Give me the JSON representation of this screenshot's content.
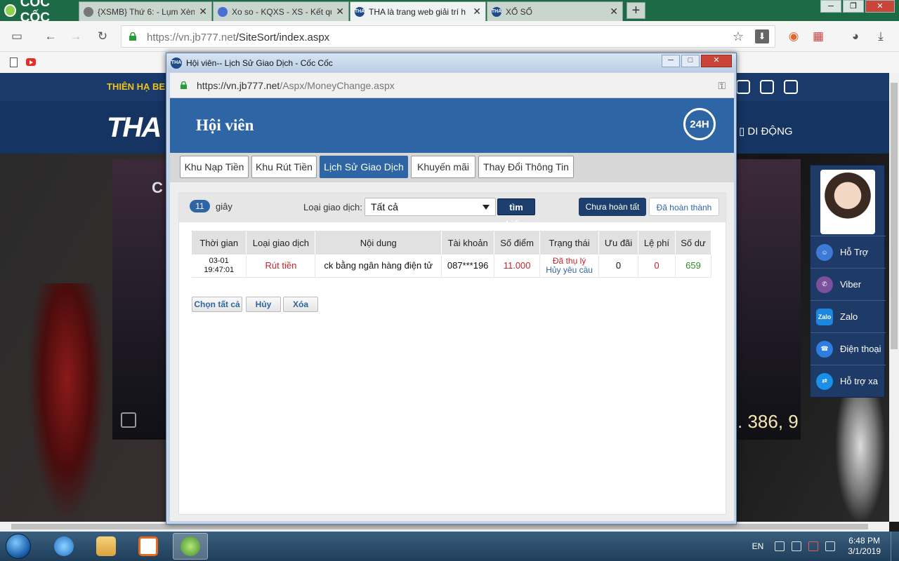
{
  "browser": {
    "brand": "CỐC CỐC",
    "tabs": [
      {
        "label": "{XSMB} Thứ 6: - Lụm Xèn",
        "color": "#777777"
      },
      {
        "label": "Xo so - KQXS - XS - Kết qu",
        "color": "#4a6fd0"
      },
      {
        "label": "THA là trang web giải trí h",
        "color": "#1d4c8c"
      },
      {
        "label": "XỔ SỐ",
        "color": "#1d4c8c"
      }
    ],
    "new_tab": "+",
    "url_host": "https://vn.jb777.net",
    "url_path": "/SiteSort/index.aspx"
  },
  "site": {
    "slogan": "THIÊN HẠ BE",
    "logo": "THA",
    "mobile": "DI ĐỘNG",
    "banner_letter": "C",
    "jackpot": ". 386, 9",
    "support": [
      {
        "label": "Hỗ Trợ",
        "color": "#3d7ad6"
      },
      {
        "label": "Viber",
        "color": "#7b519d"
      },
      {
        "label": "Zalo",
        "color": "#1c86e0"
      },
      {
        "label": "Điện thoại",
        "color": "#2d7ee0"
      },
      {
        "label": "Hỗ trợ xa",
        "color": "#1b8ee8"
      }
    ]
  },
  "popup": {
    "window_title": "Hội viên-- Lịch Sử Giao Dịch - Cốc Cốc",
    "url_host": "https://vn.jb777.net",
    "url_path": "/Aspx/MoneyChange.aspx",
    "header_title": "Hội viên",
    "support_badge": "24H",
    "tabs": [
      {
        "label": "Khu Nạp Tiền"
      },
      {
        "label": "Khu Rút Tiền"
      },
      {
        "label": "Lịch Sử Giao Dịch"
      },
      {
        "label": "Khuyến mãi"
      },
      {
        "label": "Thay Đổi Thông Tin"
      }
    ],
    "refresh_seconds": "11",
    "seconds_unit": "giây",
    "type_label": "Loại giao dịch:",
    "type_value": "Tất cả",
    "search_button": "tìm kiếm",
    "status_pending": "Chưa hoàn tất",
    "status_done": "Đã hoàn thành",
    "columns": [
      "Thời gian",
      "Loại giao dịch",
      "Nội dung",
      "Tài khoản",
      "Số điểm",
      "Trạng thái",
      "Ưu đãi",
      "Lệ phí",
      "Số dư"
    ],
    "rows": [
      {
        "date": "03-01",
        "time": "19:47:01",
        "type": "Rút tiền",
        "content": "ck bằng ngân hàng điện tử",
        "account": "087***196",
        "points": "11.000",
        "status": "Đã thụ lý",
        "status_action": "Hủy yêu cầu",
        "bonus": "0",
        "fee": "0",
        "balance": "659"
      }
    ],
    "select_all": "Chọn tất cả",
    "cancel": "Hủy",
    "delete": "Xóa"
  },
  "taskbar": {
    "language": "EN",
    "time": "6:48 PM",
    "date": "3/1/2019"
  }
}
